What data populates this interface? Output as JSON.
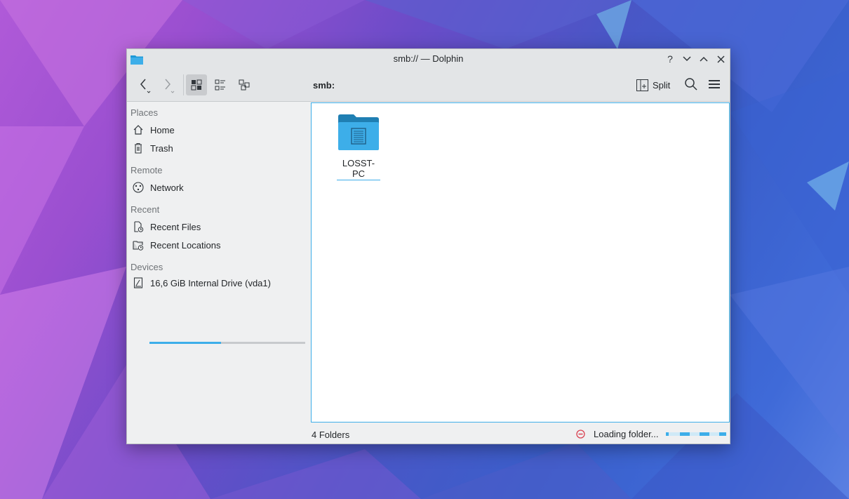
{
  "window": {
    "title": "smb:// — Dolphin"
  },
  "titlebar_buttons": {
    "help": "?",
    "minimize": "⌄",
    "maximize": "⌃",
    "close": "✕"
  },
  "toolbar": {
    "location": "smb:",
    "split_label": "Split"
  },
  "sidebar": {
    "places_title": "Places",
    "home": "Home",
    "trash": "Trash",
    "remote_title": "Remote",
    "network": "Network",
    "recent_title": "Recent",
    "recent_files": "Recent Files",
    "recent_locations": "Recent Locations",
    "devices_title": "Devices",
    "drive": "16,6 GiB Internal Drive (vda1)",
    "drive_usage_fraction": 0.46
  },
  "main": {
    "items": [
      {
        "label": "LOSST-PC",
        "icon": "network-folder-icon"
      }
    ]
  },
  "statusbar": {
    "summary": "4 Folders",
    "loading": "Loading folder..."
  },
  "colors": {
    "accent": "#3daee9",
    "folder": "#3daee9",
    "stop": "#da4453"
  }
}
